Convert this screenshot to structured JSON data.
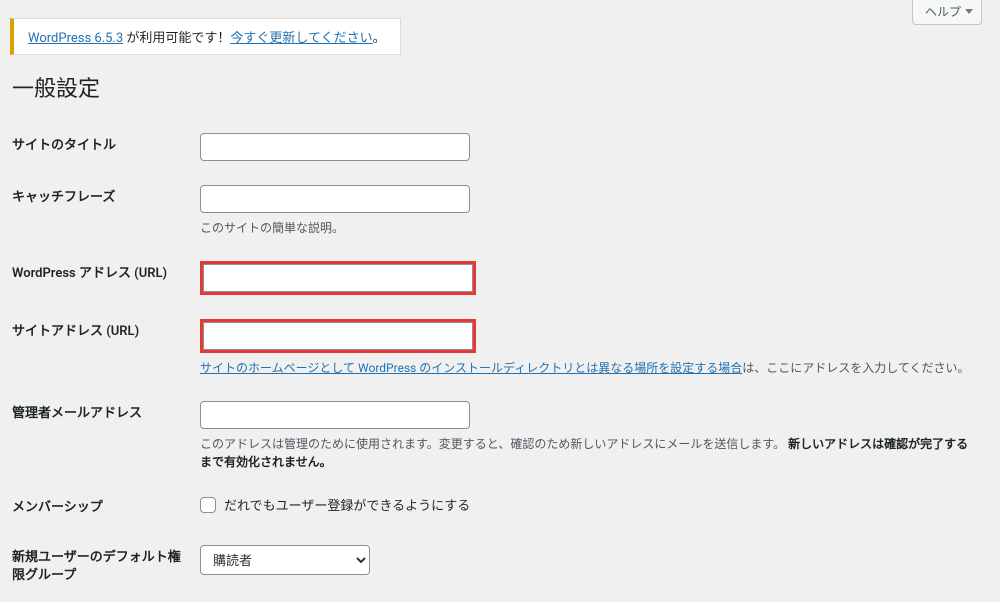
{
  "help_tab": {
    "label": "ヘルプ"
  },
  "update_nag": {
    "version_link": "WordPress 6.5.3",
    "middle_text": " が利用可能です！",
    "action_link": "今すぐ更新してください",
    "trailing": "。"
  },
  "page_title": "一般設定",
  "rows": {
    "site_title": {
      "label": "サイトのタイトル",
      "value": ""
    },
    "tagline": {
      "label": "キャッチフレーズ",
      "value": "",
      "description": "このサイトの簡単な説明。"
    },
    "wp_url": {
      "label": "WordPress アドレス (URL)",
      "value": ""
    },
    "site_url": {
      "label": "サイトアドレス (URL)",
      "value": "",
      "desc_link": "サイトのホームページとして WordPress のインストールディレクトリとは異なる場所を設定する場合",
      "desc_tail": "は、ここにアドレスを入力してください。"
    },
    "admin_email": {
      "label": "管理者メールアドレス",
      "value": "",
      "desc_plain": "このアドレスは管理のために使用されます。変更すると、確認のため新しいアドレスにメールを送信します。",
      "desc_strong": "新しいアドレスは確認が完了するまで有効化されません。"
    },
    "membership": {
      "label": "メンバーシップ",
      "checkbox_label": "だれでもユーザー登録ができるようにする",
      "checked": false
    },
    "default_role": {
      "label": "新規ユーザーのデフォルト権限グループ",
      "selected": "購読者"
    }
  }
}
